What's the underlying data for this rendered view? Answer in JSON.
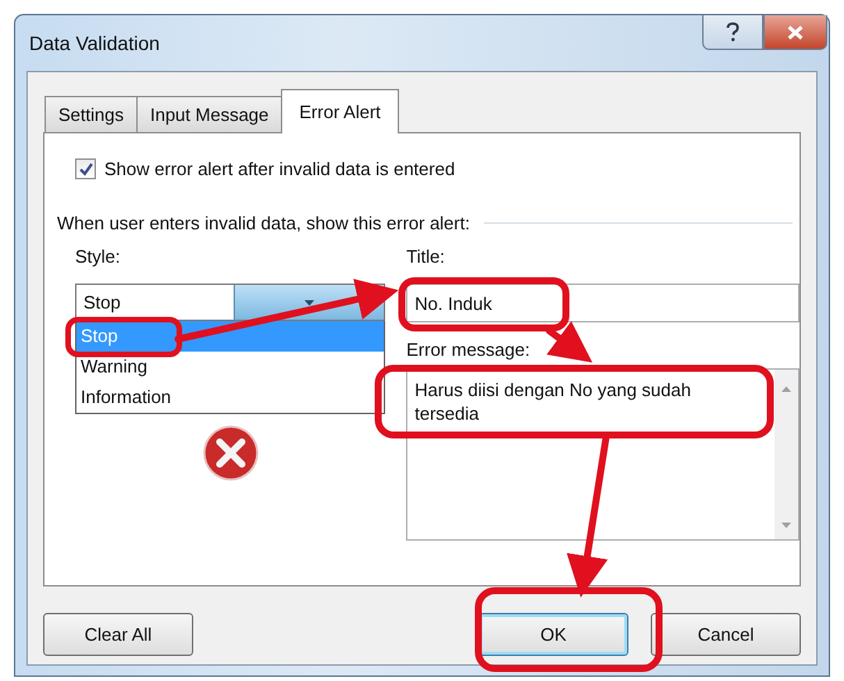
{
  "window": {
    "title": "Data Validation"
  },
  "tabs": [
    {
      "label": "Settings",
      "selected": false
    },
    {
      "label": "Input Message",
      "selected": false
    },
    {
      "label": "Error Alert",
      "selected": true
    }
  ],
  "show_error_alert": {
    "label": "Show error alert after invalid data is entered",
    "checked": true
  },
  "group_label": "When user enters invalid data, show this error alert:",
  "style": {
    "label": "Style:",
    "value": "Stop",
    "expanded": true,
    "options": [
      {
        "label": "Stop",
        "selected": true
      },
      {
        "label": "Warning",
        "selected": false
      },
      {
        "label": "Information",
        "selected": false
      }
    ]
  },
  "title_field": {
    "label": "Title:",
    "value": "No. Induk"
  },
  "error_message": {
    "label": "Error message:",
    "value": "Harus diisi dengan No yang sudah tersedia"
  },
  "buttons": [
    {
      "label": "Clear All",
      "default": false
    },
    {
      "label": "OK",
      "default": true
    },
    {
      "label": "Cancel",
      "default": false
    }
  ]
}
